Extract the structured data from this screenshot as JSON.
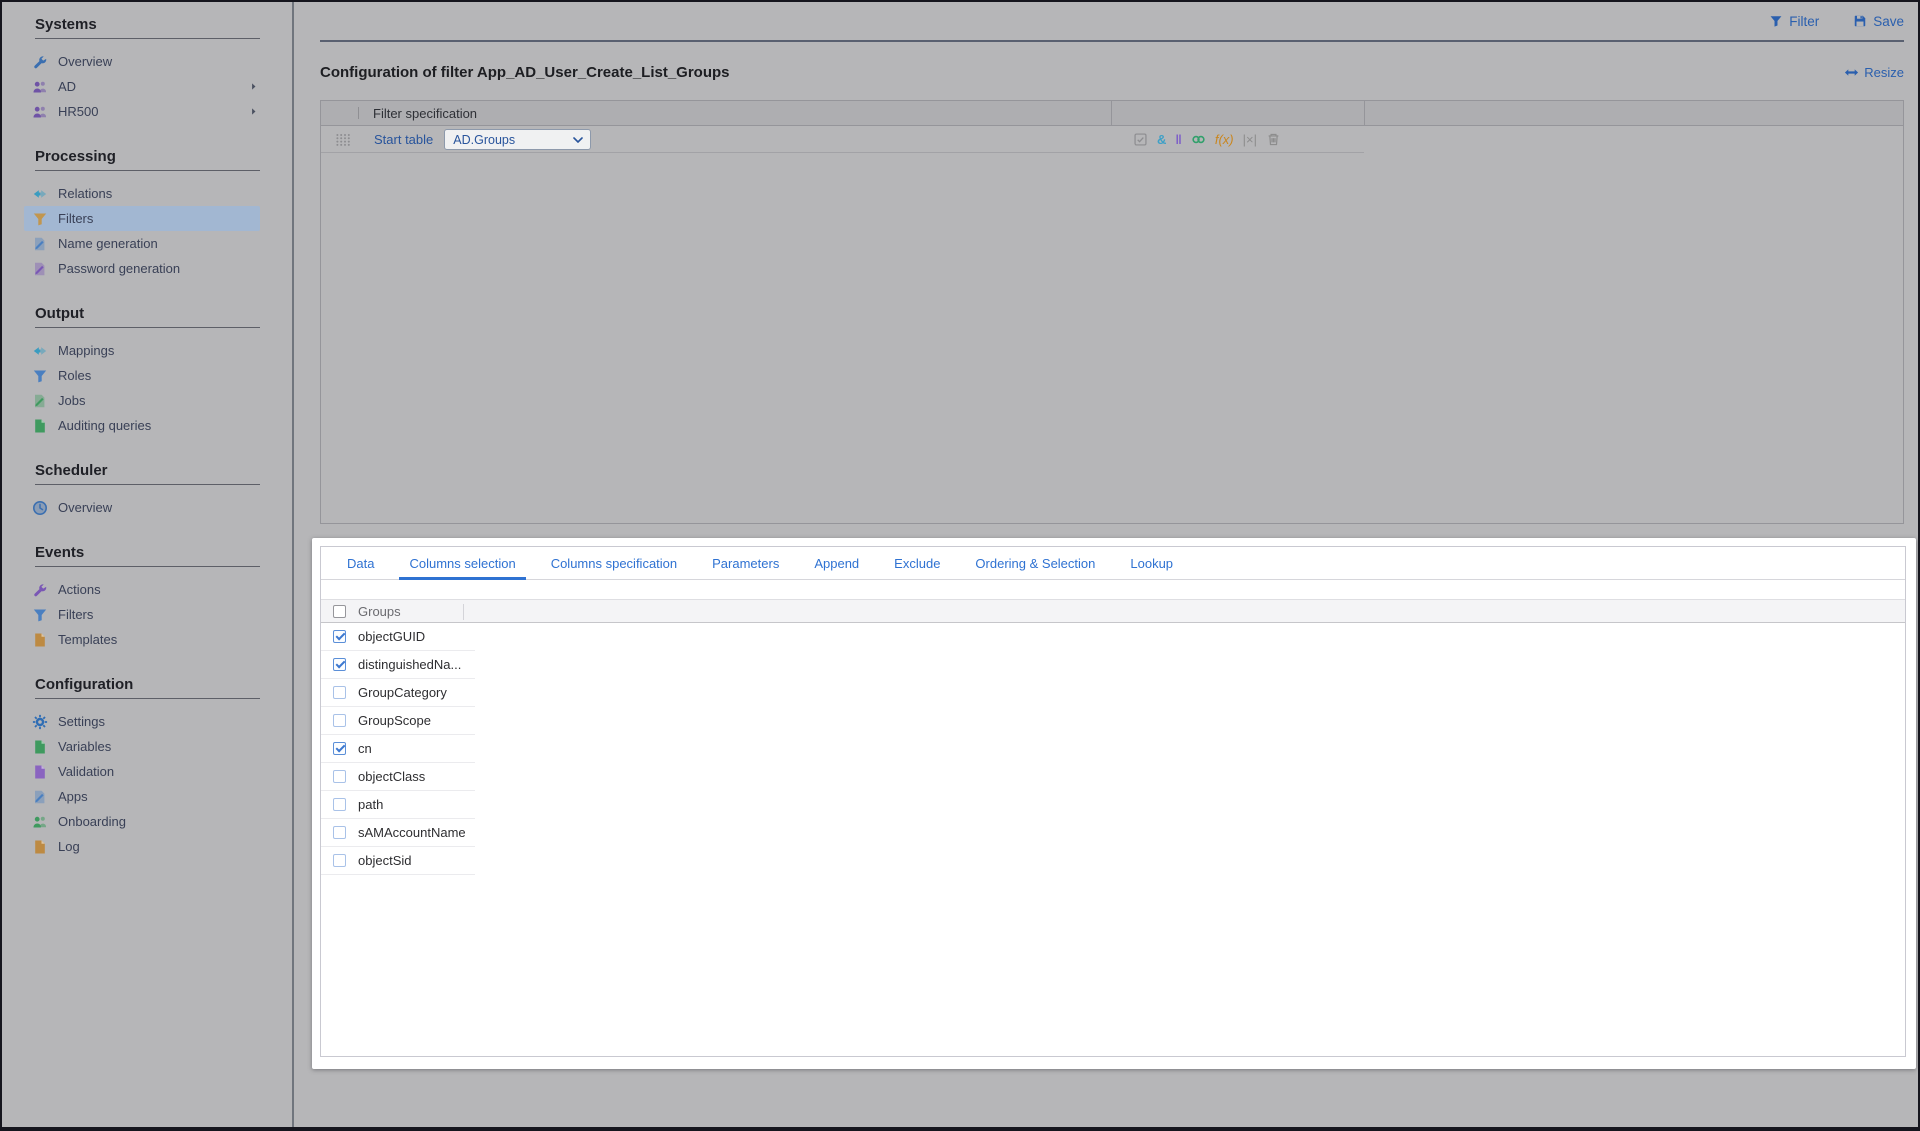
{
  "header": {
    "filter_label": "Filter",
    "save_label": "Save"
  },
  "page": {
    "title": "Configuration of filter App_AD_User_Create_List_Groups",
    "resize_label": "Resize"
  },
  "sidebar": {
    "sections": [
      {
        "title": "Systems",
        "items": [
          {
            "label": "Overview",
            "icon": "wrench-icon",
            "color": "#3b6fb0"
          },
          {
            "label": "AD",
            "icon": "users-icon",
            "color": "#6f53a6",
            "expandable": true
          },
          {
            "label": "HR500",
            "icon": "users-icon",
            "color": "#6f53a6",
            "expandable": true
          }
        ]
      },
      {
        "title": "Processing",
        "items": [
          {
            "label": "Relations",
            "icon": "relation-arrows-icon",
            "color": "#3a9cc0"
          },
          {
            "label": "Filters",
            "icon": "funnel-icon",
            "color": "#c1964f",
            "selected": true
          },
          {
            "label": "Name generation",
            "icon": "doc-pencil-icon",
            "color": "#4a7fc0"
          },
          {
            "label": "Password generation",
            "icon": "doc-pencil-icon",
            "color": "#7a57b5"
          }
        ]
      },
      {
        "title": "Output",
        "items": [
          {
            "label": "Mappings",
            "icon": "relation-arrows-icon",
            "color": "#3a9cc0"
          },
          {
            "label": "Roles",
            "icon": "funnel-icon",
            "color": "#4a7fc0"
          },
          {
            "label": "Jobs",
            "icon": "doc-pencil-icon",
            "color": "#3f9a5f"
          },
          {
            "label": "Auditing queries",
            "icon": "doc-icon",
            "color": "#3f9a5f"
          }
        ]
      },
      {
        "title": "Scheduler",
        "items": [
          {
            "label": "Overview",
            "icon": "clock-icon",
            "color": "#3b6fb0"
          }
        ]
      },
      {
        "title": "Events",
        "items": [
          {
            "label": "Actions",
            "icon": "wrench-icon",
            "color": "#7a57b5"
          },
          {
            "label": "Filters",
            "icon": "funnel-icon",
            "color": "#4a7fc0"
          },
          {
            "label": "Templates",
            "icon": "doc-icon",
            "color": "#bd8a42"
          }
        ]
      },
      {
        "title": "Configuration",
        "items": [
          {
            "label": "Settings",
            "icon": "gear-icon",
            "color": "#2f6db4"
          },
          {
            "label": "Variables",
            "icon": "doc-icon",
            "color": "#3f9a5f"
          },
          {
            "label": "Validation",
            "icon": "doc-icon",
            "color": "#8a64c0"
          },
          {
            "label": "Apps",
            "icon": "doc-pencil-icon",
            "color": "#4a7fc0"
          },
          {
            "label": "Onboarding",
            "icon": "users-icon",
            "color": "#3f9a5f"
          },
          {
            "label": "Log",
            "icon": "doc-icon",
            "color": "#bd8a42"
          }
        ]
      }
    ]
  },
  "filter_grid": {
    "header_title": "Filter specification",
    "row": {
      "label": "Start table",
      "dropdown_value": "AD.Groups",
      "icons": [
        {
          "name": "checkbox-validate-icon",
          "color": "#8d8d90"
        },
        {
          "name": "and-operator-icon",
          "glyph": "&",
          "color": "#3fa0c6"
        },
        {
          "name": "parallel-operator-icon",
          "glyph": "‖",
          "color": "#7e60c8"
        },
        {
          "name": "link-icon",
          "color": "#31a06b"
        },
        {
          "name": "function-icon",
          "glyph": "f(x)",
          "color": "#c9861f"
        },
        {
          "name": "clear-value-icon",
          "glyph": "|×|",
          "color": "#8d8d8d"
        },
        {
          "name": "trash-icon",
          "color": "#8d8d8d"
        }
      ]
    }
  },
  "panel": {
    "tabs": [
      {
        "label": "Data"
      },
      {
        "label": "Columns selection",
        "active": true
      },
      {
        "label": "Columns specification"
      },
      {
        "label": "Parameters"
      },
      {
        "label": "Append"
      },
      {
        "label": "Exclude"
      },
      {
        "label": "Ordering & Selection"
      },
      {
        "label": "Lookup"
      }
    ],
    "table": {
      "header": "Groups",
      "rows": [
        {
          "label": "objectGUID",
          "checked": true
        },
        {
          "label": "distinguishedNa...",
          "checked": true
        },
        {
          "label": "GroupCategory",
          "checked": false
        },
        {
          "label": "GroupScope",
          "checked": false
        },
        {
          "label": "cn",
          "checked": true
        },
        {
          "label": "objectClass",
          "checked": false
        },
        {
          "label": "path",
          "checked": false
        },
        {
          "label": "sAMAccountName",
          "checked": false
        },
        {
          "label": "objectSid",
          "checked": false
        }
      ]
    }
  },
  "colors": {
    "dim_background": "#b6b6b8",
    "dim_link_blue": "#2a5fae",
    "bright_tab_blue": "#2f72d2",
    "selected_sidebar_item": "#a2b7d2",
    "checkbox_check": "#3c78d0",
    "panel_background": "#ffffff"
  }
}
